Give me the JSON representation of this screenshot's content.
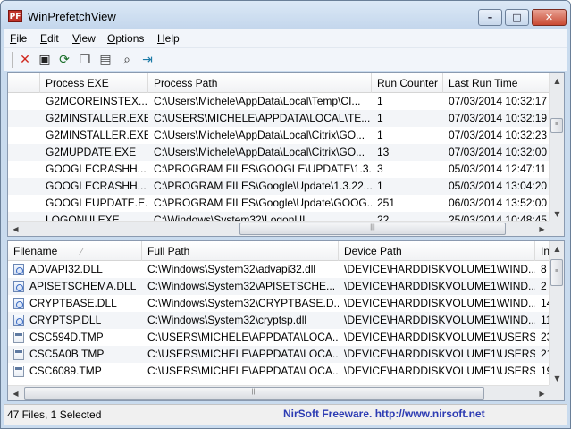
{
  "window": {
    "title": "WinPrefetchView",
    "app_icon_text": "PF"
  },
  "menu": [
    "File",
    "Edit",
    "View",
    "Options",
    "Help"
  ],
  "toolbar": [
    "delete-icon",
    "save-icon",
    "refresh-icon",
    "copy-icon",
    "properties-icon",
    "find-icon",
    "exit-icon"
  ],
  "prefetch_table": {
    "columns": [
      "Process EXE",
      "Process Path",
      "Run Counter",
      "Last Run Time"
    ],
    "rows": [
      {
        "exe": "G2MCOREINSTEX...",
        "path": "C:\\Users\\Michele\\AppData\\Local\\Temp\\CI...",
        "count": "1",
        "time": "07/03/2014 10:32:17"
      },
      {
        "exe": "G2MINSTALLER.EXE",
        "path": "C:\\USERS\\MICHELE\\APPDATA\\LOCAL\\TE...",
        "count": "1",
        "time": "07/03/2014 10:32:19"
      },
      {
        "exe": "G2MINSTALLER.EXE",
        "path": "C:\\Users\\Michele\\AppData\\Local\\Citrix\\GO...",
        "count": "1",
        "time": "07/03/2014 10:32:23"
      },
      {
        "exe": "G2MUPDATE.EXE",
        "path": "C:\\Users\\Michele\\AppData\\Local\\Citrix\\GO...",
        "count": "13",
        "time": "07/03/2014 10:32:00"
      },
      {
        "exe": "GOOGLECRASHH...",
        "path": "C:\\PROGRAM FILES\\GOOGLE\\UPDATE\\1.3....",
        "count": "3",
        "time": "05/03/2014 12:47:11"
      },
      {
        "exe": "GOOGLECRASHH...",
        "path": "C:\\PROGRAM FILES\\Google\\Update\\1.3.22....",
        "count": "1",
        "time": "05/03/2014 13:04:20"
      },
      {
        "exe": "GOOGLEUPDATE.E...",
        "path": "C:\\PROGRAM FILES\\Google\\Update\\GOOG...",
        "count": "251",
        "time": "06/03/2014 13:52:00"
      },
      {
        "exe": "LOGONUI.EXE",
        "path": "C:\\Windows\\System32\\LogonUI...",
        "count": "22",
        "time": "25/03/2014 10:48:45"
      }
    ]
  },
  "files_table": {
    "columns": [
      "Filename",
      "Full Path",
      "Device Path",
      "In"
    ],
    "rows": [
      {
        "name": "ADVAPI32.DLL",
        "type": "dll",
        "path": "C:\\Windows\\System32\\advapi32.dll",
        "device": "\\DEVICE\\HARDDISKVOLUME1\\WIND...",
        "index": "8"
      },
      {
        "name": "APISETSCHEMA.DLL",
        "type": "dll",
        "path": "C:\\Windows\\System32\\APISETSCHE...",
        "device": "\\DEVICE\\HARDDISKVOLUME1\\WIND...",
        "index": "2"
      },
      {
        "name": "CRYPTBASE.DLL",
        "type": "dll",
        "path": "C:\\Windows\\System32\\CRYPTBASE.D...",
        "device": "\\DEVICE\\HARDDISKVOLUME1\\WIND...",
        "index": "14"
      },
      {
        "name": "CRYPTSP.DLL",
        "type": "dll",
        "path": "C:\\Windows\\System32\\cryptsp.dll",
        "device": "\\DEVICE\\HARDDISKVOLUME1\\WIND...",
        "index": "11"
      },
      {
        "name": "CSC594D.TMP",
        "type": "tmp",
        "path": "C:\\USERS\\MICHELE\\APPDATA\\LOCA...",
        "device": "\\DEVICE\\HARDDISKVOLUME1\\USERS...",
        "index": "23"
      },
      {
        "name": "CSC5A0B.TMP",
        "type": "tmp",
        "path": "C:\\USERS\\MICHELE\\APPDATA\\LOCA...",
        "device": "\\DEVICE\\HARDDISKVOLUME1\\USERS...",
        "index": "21"
      },
      {
        "name": "CSC6089.TMP",
        "type": "tmp",
        "path": "C:\\USERS\\MICHELE\\APPDATA\\LOCA...",
        "device": "\\DEVICE\\HARDDISKVOLUME1\\USERS...",
        "index": "19"
      }
    ]
  },
  "status": {
    "left": "47 Files, 1 Selected",
    "right": "NirSoft Freeware.  http://www.nirsoft.net"
  }
}
